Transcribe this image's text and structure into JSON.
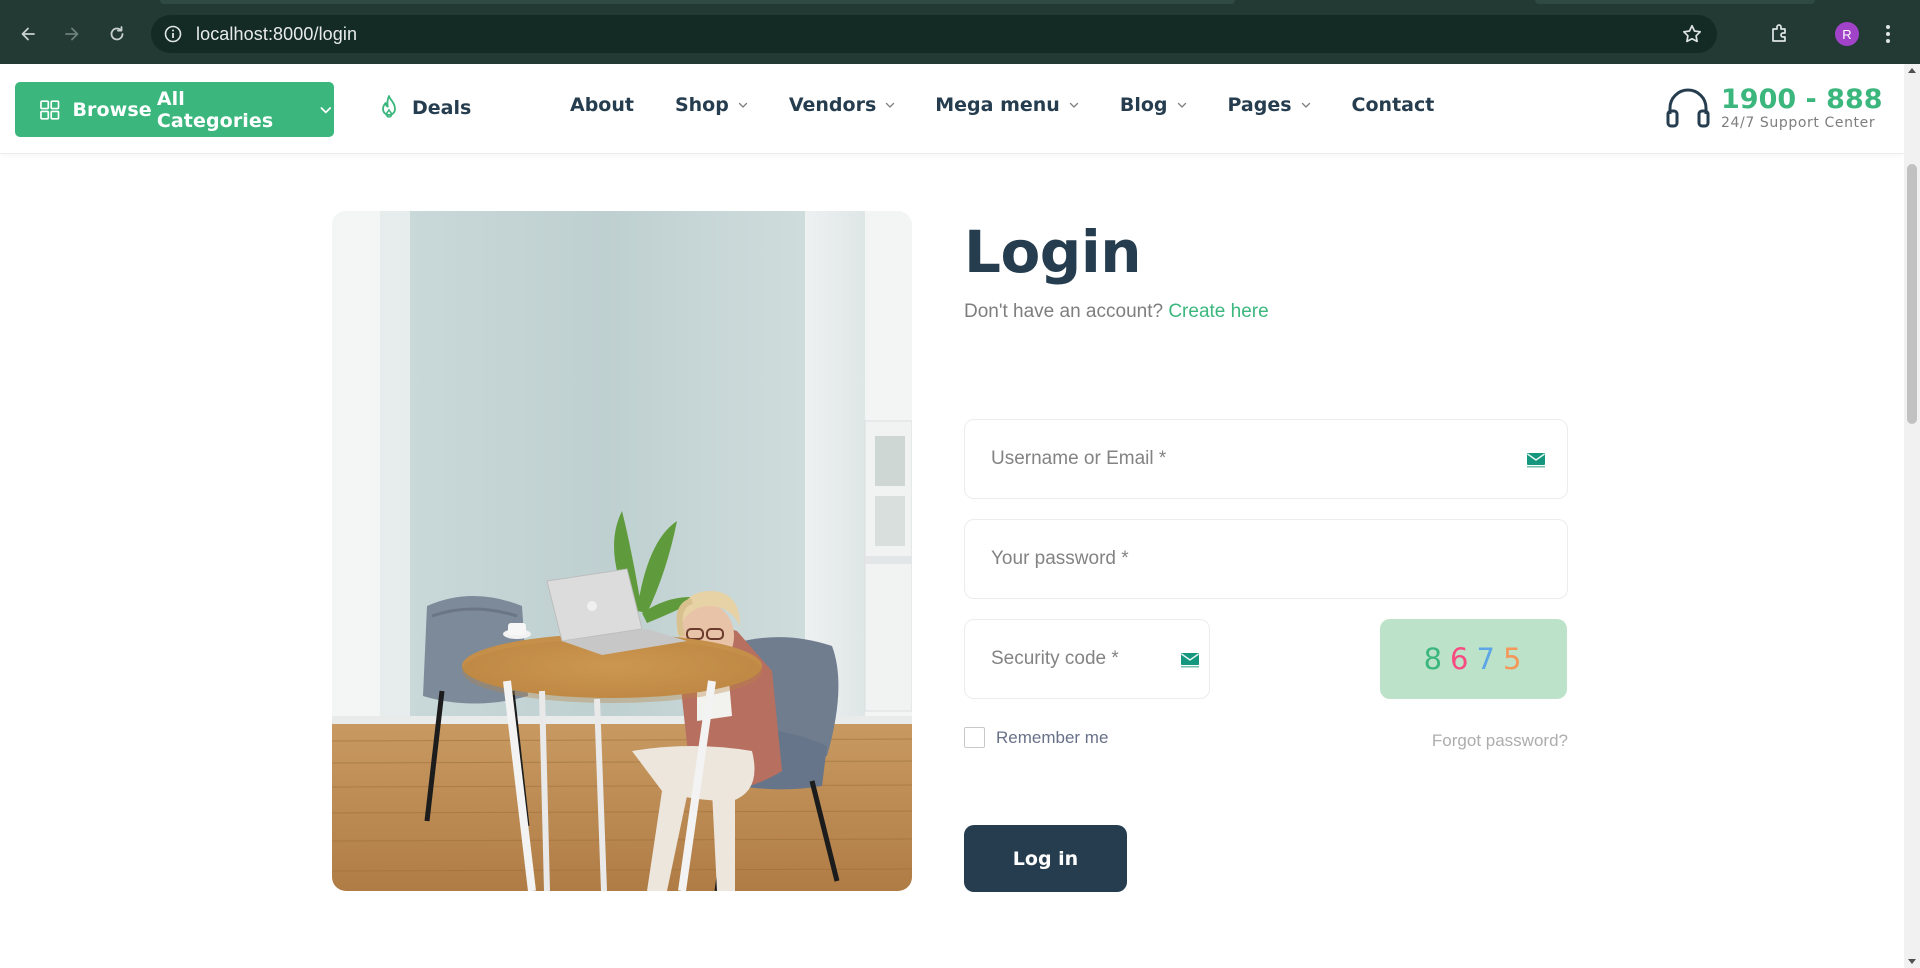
{
  "browser": {
    "url": "localhost:8000/login",
    "profile_initial": "R"
  },
  "header": {
    "browse_label": "Browse",
    "browse_label2": "All Categories",
    "deals_label": "Deals",
    "nav": [
      {
        "label": "About",
        "has_dropdown": false
      },
      {
        "label": "Shop",
        "has_dropdown": true
      },
      {
        "label": "Vendors",
        "has_dropdown": true
      },
      {
        "label": "Mega menu",
        "has_dropdown": true
      },
      {
        "label": "Blog",
        "has_dropdown": true
      },
      {
        "label": "Pages",
        "has_dropdown": true
      },
      {
        "label": "Contact",
        "has_dropdown": false
      }
    ],
    "support_phone": "1900 - 888",
    "support_sub": "24/7 Support Center"
  },
  "login": {
    "title": "Login",
    "no_account_text": "Don't have an account?",
    "create_link": "Create here",
    "username_placeholder": "Username or Email *",
    "password_placeholder": "Your password *",
    "security_placeholder": "Security code *",
    "captcha_digits": [
      {
        "digit": "8",
        "color": "#3bb77e"
      },
      {
        "digit": "6",
        "color": "#f74b81"
      },
      {
        "digit": "7",
        "color": "#5ca5e6"
      },
      {
        "digit": "5",
        "color": "#f59758"
      }
    ],
    "remember_label": "Remember me",
    "forgot_label": "Forgot password?",
    "submit_label": "Log in"
  },
  "colors": {
    "brand_green": "#3bb77e",
    "heading": "#253d4e",
    "captcha_bg": "#bce3c9"
  }
}
